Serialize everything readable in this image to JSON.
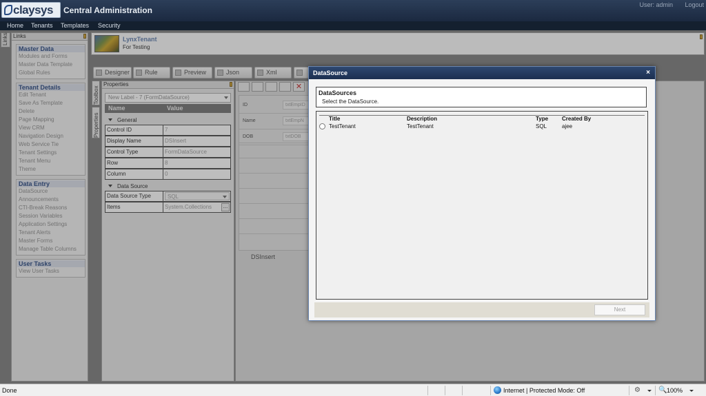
{
  "header": {
    "logo_text": "claysys",
    "app_title": "Central Administration",
    "user_label": "User: admin",
    "logout": "Logout"
  },
  "nav": [
    "Home",
    "Tenants",
    "Templates",
    "Security"
  ],
  "links": {
    "tab": "Links",
    "title": "Links",
    "groups": [
      {
        "title": "Master Data",
        "items": [
          "Modules and Forms",
          "Master Data Template",
          "Global Rules"
        ]
      },
      {
        "title": "Tenant Details",
        "items": [
          "Edit Tenant",
          "Save As Template",
          "Delete",
          "Page Mapping",
          "View CRM",
          "Navigation Design",
          "Web Service Tie",
          "Tenant Settings",
          "Tenant Menu",
          "Theme"
        ]
      },
      {
        "title": "Data Entry",
        "items": [
          "DataSource",
          "Announcements",
          "CTI-Break Reasons",
          "Session Variables",
          "Application Settings",
          "Tenant Alerts",
          "Master Forms",
          "Manage Table Columns"
        ]
      },
      {
        "title": "User Tasks",
        "items": [
          "View User Tasks"
        ]
      }
    ]
  },
  "tenant": {
    "name": "LynxTenant",
    "description": "For Testing"
  },
  "toolbar": [
    "Designer",
    "Rule",
    "Preview",
    "Json",
    "Xml"
  ],
  "side_tabs": {
    "toolbox": "Toolbox",
    "properties": "Properties"
  },
  "properties": {
    "title": "Properties",
    "selected": "New Label - 7 (FormDataSource)",
    "col_name": "Name",
    "col_value": "Value",
    "general_label": "General",
    "general": [
      {
        "k": "Control ID",
        "v": "7"
      },
      {
        "k": "Display Name",
        "v": "DSInsert"
      },
      {
        "k": "Control Type",
        "v": "FormDataSource"
      },
      {
        "k": "Row",
        "v": "8"
      },
      {
        "k": "Column",
        "v": "0"
      }
    ],
    "datasource_label": "Data Source",
    "ds_type_key": "Data Source Type",
    "ds_type_val": "SQL",
    "items_key": "Items",
    "items_val": "System.Collections",
    "dots": "..."
  },
  "canvas": {
    "fields": [
      {
        "label": "ID",
        "box": "txtEmpID"
      },
      {
        "label": "Name",
        "box": "txtEmpN"
      },
      {
        "label": "DOB",
        "box": "txtDOB"
      }
    ],
    "control_label": "DSInsert"
  },
  "modal": {
    "title": "DataSource",
    "close": "×",
    "section_title": "DataSources",
    "section_sub": "Select the  DataSource.",
    "columns": [
      "Title",
      "Description",
      "Type",
      "Created By"
    ],
    "rows": [
      {
        "title": "TestTenant",
        "description": "TestTenant",
        "type": "SQL",
        "created_by": "ajee"
      }
    ],
    "next": "Next"
  },
  "status": {
    "done": "Done",
    "zone": "Internet | Protected Mode: Off",
    "zoom": "100%"
  }
}
